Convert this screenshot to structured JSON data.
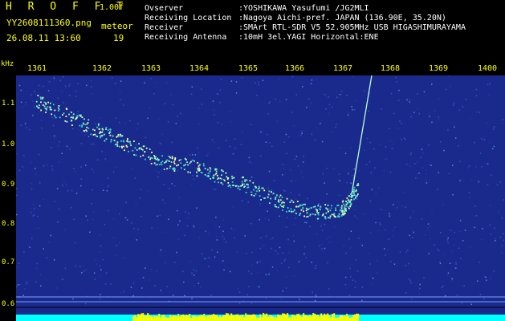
{
  "header": {
    "app_title": "H R O F F T",
    "version": "1.00f",
    "file_name": "YY2608111360.png",
    "meteor_label": "meteor",
    "timestamp": "26.08.11 13:60",
    "meteor_count": "19",
    "info": [
      {
        "label": "Ovserver",
        "value": ":YOSHIKAWA Yasufumi /JG2MLI"
      },
      {
        "label": "Receiving Location",
        "value": ":Nagoya Aichi-pref. JAPAN (136.90E, 35.20N)"
      },
      {
        "label": "Receiver",
        "value": ":SMArt RTL-SDR V5 52.905MHz USB HIGASHIMURAYAMA"
      },
      {
        "label": "Receiving Antenna",
        "value": ":10mH 3el.YAGI Horizontal:ENE"
      }
    ]
  },
  "chart_data": {
    "type": "heatmap",
    "ylabel": "kHz",
    "x_ticks": [
      "1361",
      "1362",
      "1363",
      "1364",
      "1365",
      "1366",
      "1367",
      "1368",
      "1369",
      "1400"
    ],
    "y_ticks": [
      "1.1",
      "1.0",
      "0.9",
      "0.8",
      "0.7",
      "0.6"
    ],
    "ylim": [
      0.58,
      1.15
    ],
    "trace_points": [
      {
        "x": 1361.0,
        "y": 1.09
      },
      {
        "x": 1361.5,
        "y": 1.06
      },
      {
        "x": 1362.0,
        "y": 1.03
      },
      {
        "x": 1362.5,
        "y": 1.0
      },
      {
        "x": 1363.0,
        "y": 0.97
      },
      {
        "x": 1363.5,
        "y": 0.94
      },
      {
        "x": 1364.0,
        "y": 0.93
      },
      {
        "x": 1364.5,
        "y": 0.91
      },
      {
        "x": 1365.0,
        "y": 0.89
      },
      {
        "x": 1365.5,
        "y": 0.86
      },
      {
        "x": 1366.0,
        "y": 0.83
      },
      {
        "x": 1366.5,
        "y": 0.82
      },
      {
        "x": 1366.9,
        "y": 0.82
      },
      {
        "x": 1367.1,
        "y": 0.84
      },
      {
        "x": 1367.3,
        "y": 0.88
      }
    ],
    "colors": {
      "background": "#1a2a8c",
      "trace": "#7fffd0",
      "axis_text": "#ffff00",
      "bottom_bar": "#ffff00",
      "bottom_base": "#00ffff"
    }
  }
}
